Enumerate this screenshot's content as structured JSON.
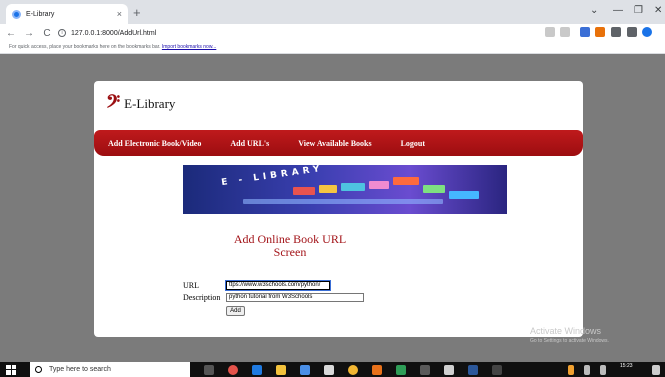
{
  "browser": {
    "tab_title": "E-Library",
    "tab_close": "×",
    "new_tab": "+",
    "url": "127.0.0.1:8000/AddUrl.html",
    "back": "←",
    "forward": "→",
    "reload": "C",
    "window_controls": [
      "⌄",
      "—",
      "❐",
      "✕"
    ],
    "bookmarks_prompt": "For quick access, place your bookmarks here on the bookmarks bar.",
    "bookmarks_link": "Import bookmarks now..."
  },
  "site": {
    "logo_glyph": "𝄢",
    "logo_text": "E-Library",
    "menu": [
      {
        "label": "Add Electronic Book/Video"
      },
      {
        "label": "Add URL's"
      },
      {
        "label": "View Available Books"
      },
      {
        "label": "Logout"
      }
    ],
    "banner_text": "E - LIBRARY",
    "heading_line1": "Add Online Book URL",
    "heading_line2": "Screen"
  },
  "form": {
    "url_label": "URL",
    "url_value": "ttps://www.w3schools.com/python/",
    "description_label": "Description",
    "description_value": "python tutorial from W3Schools",
    "add_label": "Add"
  },
  "watermark": {
    "line1": "Activate Windows",
    "line2": "Go to Settings to activate Windows."
  },
  "taskbar": {
    "search_placeholder": "Type here to search",
    "time": "15:23"
  },
  "colors": {
    "menu_red": "#b3151a",
    "heading_red": "#a31419",
    "page_gray": "#7b7b7b"
  }
}
